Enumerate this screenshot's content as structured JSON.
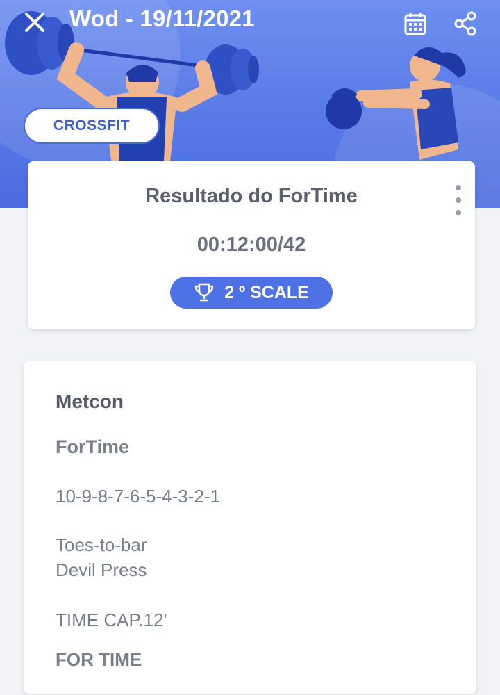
{
  "header": {
    "title": "Wod - 19/11/2021",
    "category_tag": "CROSSFIT",
    "icons": [
      "close-icon",
      "calendar-icon",
      "share-icon"
    ]
  },
  "result_card": {
    "title": "Resultado do ForTime",
    "time": "00:12:00/42",
    "badge_label": "2 º SCALE",
    "badge_icon": "trophy-icon"
  },
  "metcon_card": {
    "title": "Metcon",
    "type": "ForTime",
    "reps_scheme": "10-9-8-7-6-5-4-3-2-1",
    "movements": [
      "Toes-to-bar",
      "Devil Press"
    ],
    "time_cap": "TIME CAP.12'",
    "footer": "FOR TIME"
  },
  "colors": {
    "header_blue": "#5c7ee8",
    "badge_blue": "#4f71e6",
    "tag_text": "#3d5fcf",
    "background": "#f2f3f7"
  }
}
